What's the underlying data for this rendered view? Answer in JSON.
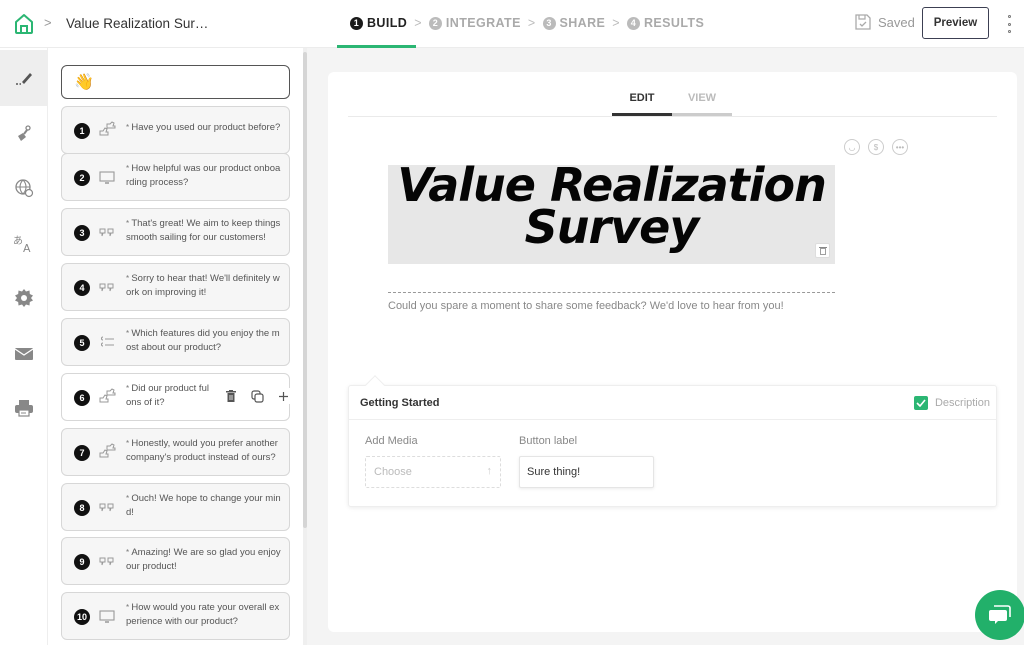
{
  "header": {
    "breadcrumb_separator": ">",
    "doc_title": "Value Realization Sur…",
    "steps": [
      {
        "num": "1",
        "label": "BUILD",
        "active": true
      },
      {
        "num": "2",
        "label": "INTEGRATE",
        "active": false
      },
      {
        "num": "3",
        "label": "SHARE",
        "active": false
      },
      {
        "num": "4",
        "label": "RESULTS",
        "active": false
      }
    ],
    "step_separator": ">",
    "saved_label": "Saved",
    "preview_label": "Preview",
    "accent_color": "#2bb673"
  },
  "rail": {
    "items": [
      {
        "icon": "pen-icon",
        "active": true
      },
      {
        "icon": "paint-brush-icon"
      },
      {
        "icon": "globe-icon"
      },
      {
        "icon": "translate-icon"
      },
      {
        "icon": "gear-icon"
      },
      {
        "icon": "mail-icon"
      },
      {
        "icon": "printer-icon"
      }
    ]
  },
  "questions": {
    "welcome_icon": "👋",
    "items": [
      {
        "num": "1",
        "type": "yes-no",
        "text": "Have you used our product before?"
      },
      {
        "num": "2",
        "type": "rating",
        "text": "How helpful was our product onboarding process?"
      },
      {
        "num": "3",
        "type": "statement",
        "text": "That's great! We aim to keep things smooth sailing for our customers!"
      },
      {
        "num": "4",
        "type": "statement",
        "text": "Sorry to hear that! We'll definitely work on improving it!"
      },
      {
        "num": "5",
        "type": "multiple-choice",
        "text": "Which features did you enjoy the most about our product?"
      },
      {
        "num": "6",
        "type": "yes-no",
        "text": "Did our product ful…ons of it?",
        "text_line1": "Did our product ful",
        "text_line2": "ons of it?"
      },
      {
        "num": "7",
        "type": "yes-no",
        "text": "Honestly, would you prefer another company's product instead of ours?"
      },
      {
        "num": "8",
        "type": "statement",
        "text": "Ouch! We hope to change your mind!"
      },
      {
        "num": "9",
        "type": "statement",
        "text": "Amazing! We are so glad you enjoy our product!"
      },
      {
        "num": "10",
        "type": "rating",
        "text": "How would you rate your overall experience with our product?"
      }
    ]
  },
  "editor": {
    "tabs": [
      {
        "label": "EDIT",
        "active": true
      },
      {
        "label": "VIEW",
        "active": false
      }
    ],
    "hero_line1": "Value Realization",
    "hero_line2": "Survey",
    "subtitle": "Could you spare a moment to share some feedback? We'd love to hear from you!",
    "settings": {
      "title": "Getting Started",
      "description_label": "Description",
      "description_checked": true,
      "add_media_label": "Add Media",
      "add_media_placeholder": "Choose",
      "button_label_label": "Button label",
      "button_label_value": "Sure thing!"
    }
  }
}
